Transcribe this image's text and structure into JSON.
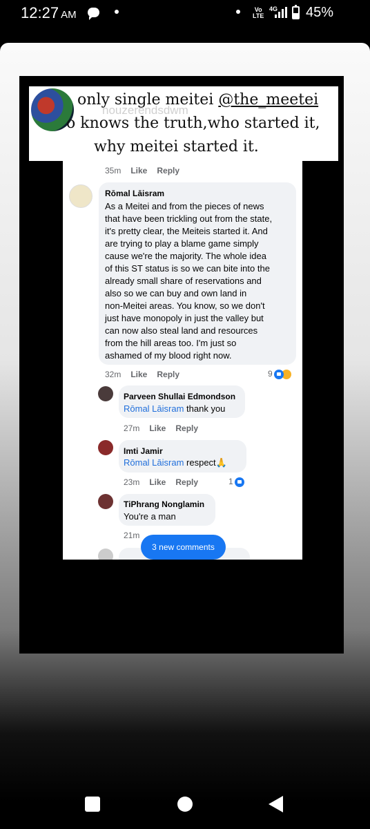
{
  "status_bar": {
    "time": "12:27",
    "ampm": "AM",
    "network_volte": "Vo\nLTE",
    "network_type": "4G",
    "battery_percent": "45%",
    "battery_level": 0.45,
    "icons": [
      "message-icon",
      "notification-dot-icon",
      "volte-icon",
      "signal-icon",
      "battery-icon"
    ]
  },
  "story": {
    "banner": {
      "line1_prefix": "only single meitei ",
      "handle": "@the_meetei",
      "line2": "o knows the truth,who started it,",
      "line3": "why meitei started it.",
      "watermark": "nouzerendsdwm"
    },
    "screenshot": {
      "top_meta": {
        "time": "35m",
        "like": "Like",
        "reply": "Reply"
      },
      "comments": [
        {
          "author": "Rōmal Lāisram",
          "lines": [
            "As a Meitei and from the pieces of news",
            "that have been trickling out from the state,",
            "it's pretty clear, the Meiteis started it. And",
            "are trying to play a blame game simply",
            "cause we're the majority. The whole idea",
            "of this ST status is so we can bite into the",
            "already small share of reservations and",
            "also so we can buy and own land in",
            "non-Meitei areas. You know, so we don't",
            "just have monopoly in just the valley but",
            "can now also steal land and resources",
            "from the hill areas too. I'm just so",
            "ashamed of my blood right now."
          ],
          "time": "32m",
          "like": "Like",
          "reply": "Reply",
          "reactions": "9"
        },
        {
          "author": "Parveen Shullai Edmondson",
          "mention": "Rōmal Lāisram",
          "text": " thank you",
          "time": "27m",
          "like": "Like",
          "reply": "Reply"
        },
        {
          "author": "Imti Jamir",
          "mention": "Rōmal Lāisram",
          "text": " respect🙏",
          "time": "23m",
          "like": "Like",
          "reply": "Reply",
          "reactions": "1"
        },
        {
          "author": "TiPhrang Nonglamin",
          "text": "You're a man",
          "time": "21m"
        }
      ],
      "new_comments_label": "3 new comments"
    }
  },
  "colors": {
    "accent": "#1877f2",
    "mention": "#216fdb",
    "bubble": "#f0f2f5"
  }
}
